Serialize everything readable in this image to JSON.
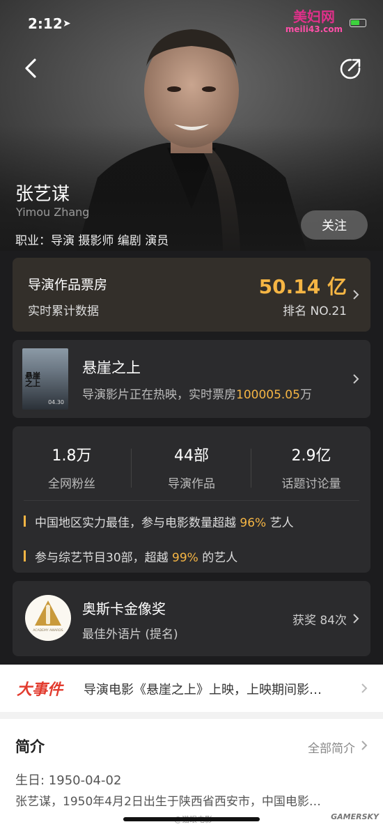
{
  "status": {
    "time": "2:12"
  },
  "watermark": {
    "title": "美妇网",
    "url": "meili43.com"
  },
  "artist": {
    "name_cn": "张艺谋",
    "name_en": "Yimou Zhang",
    "roles": "职业：导演 摄影师 编剧 演员",
    "follow_label": "关注"
  },
  "box_office": {
    "title": "导演作品票房",
    "subtitle": "实时累计数据",
    "value": "50.14 亿",
    "rank": "排名 NO.21"
  },
  "movie": {
    "poster_title": "悬崖之上",
    "poster_date": "04.30",
    "title": "悬崖之上",
    "desc_prefix": "导演影片正在热映，实时票房",
    "desc_value": "100005.05",
    "desc_suffix": "万"
  },
  "stats": {
    "items": [
      {
        "value": "1.8万",
        "label": "全网粉丝"
      },
      {
        "value": "44部",
        "label": "导演作品"
      },
      {
        "value": "2.9亿",
        "label": "话题讨论量"
      }
    ],
    "facts": [
      {
        "prefix": "中国地区实力最佳，参与电影数量超越 ",
        "highlight": "96%",
        "suffix": " 艺人"
      },
      {
        "prefix": "参与综艺节目30部，超越 ",
        "highlight": "99%",
        "suffix": " 的艺人"
      }
    ]
  },
  "award": {
    "title": "奥斯卡金像奖",
    "subtitle": "最佳外语片 (提名)",
    "count": "获奖 84次",
    "logo_text": "ACADEMY AWARDS"
  },
  "events": {
    "badge": "大事件",
    "text": "导演电影《悬崖之上》上映，上映期间影…"
  },
  "intro": {
    "title": "简介",
    "more": "全部简介",
    "birth": "生日: 1950-04-02",
    "bio": "张艺谋，1950年4月2日出生于陕西省西安市，中国电影…"
  },
  "footer": {
    "weibo": "@猫眼电影",
    "site": "GAMERSKY"
  },
  "colors": {
    "accent": "#f5b544",
    "event_red": "#e23b2e",
    "card_bg": "#2b2b2d"
  }
}
